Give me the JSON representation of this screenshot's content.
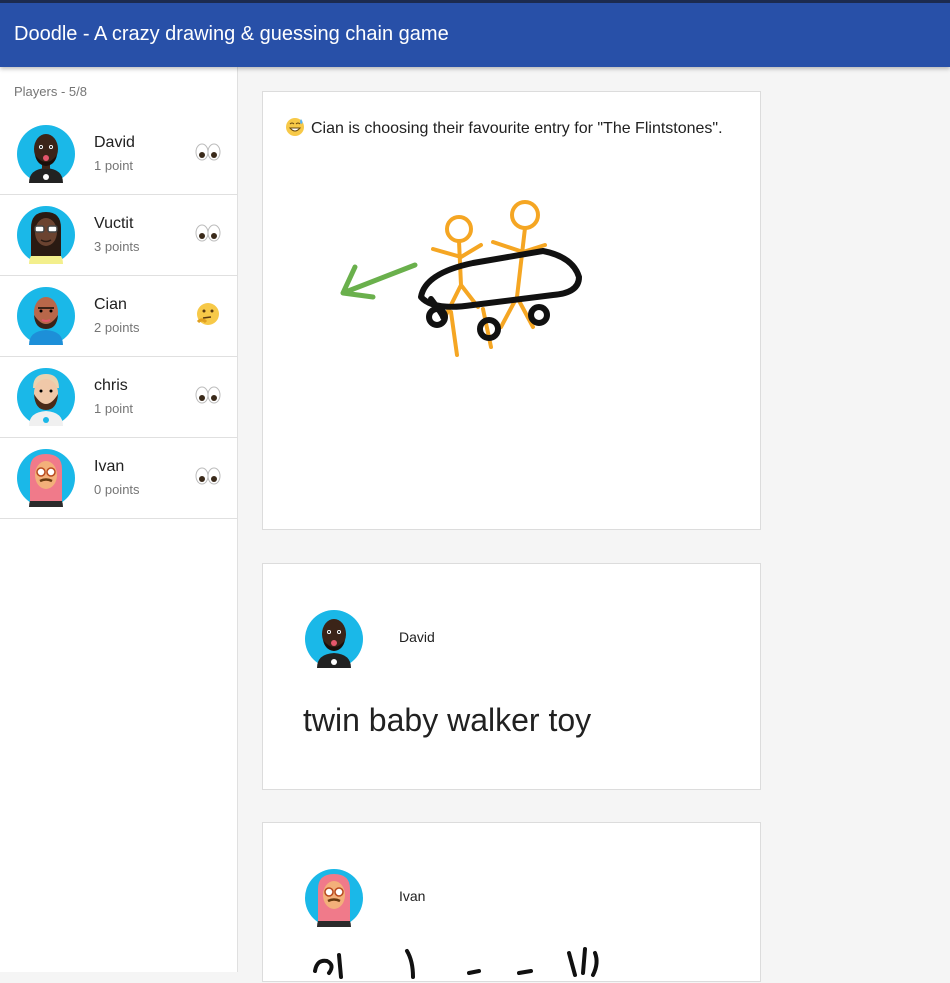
{
  "app": {
    "title": "Doodle - A crazy drawing & guessing chain game"
  },
  "sidebar": {
    "header": "Players - 5/8",
    "players": [
      {
        "name": "David",
        "points": "1 point",
        "status_icon": "eyes-icon"
      },
      {
        "name": "Vuctit",
        "points": "3 points",
        "status_icon": "eyes-icon"
      },
      {
        "name": "Cian",
        "points": "2 points",
        "status_icon": "thinking-face-icon"
      },
      {
        "name": "chris",
        "points": "1 point",
        "status_icon": "eyes-icon"
      },
      {
        "name": "Ivan",
        "points": "0 points",
        "status_icon": "eyes-icon"
      }
    ]
  },
  "main": {
    "status_card": {
      "emoji": "grinning-sweat-icon",
      "text": "Cian is choosing their favourite entry for \"The Flintstones\"."
    },
    "entries": [
      {
        "author": "David",
        "text": "twin baby walker toy"
      },
      {
        "author": "Ivan",
        "type": "drawing"
      }
    ]
  },
  "colors": {
    "appbar": "#2850a8",
    "avatar_bg": "#1ab8e8",
    "drawing_orange": "#f5a623",
    "drawing_green": "#6ab04c",
    "drawing_black": "#111111"
  }
}
